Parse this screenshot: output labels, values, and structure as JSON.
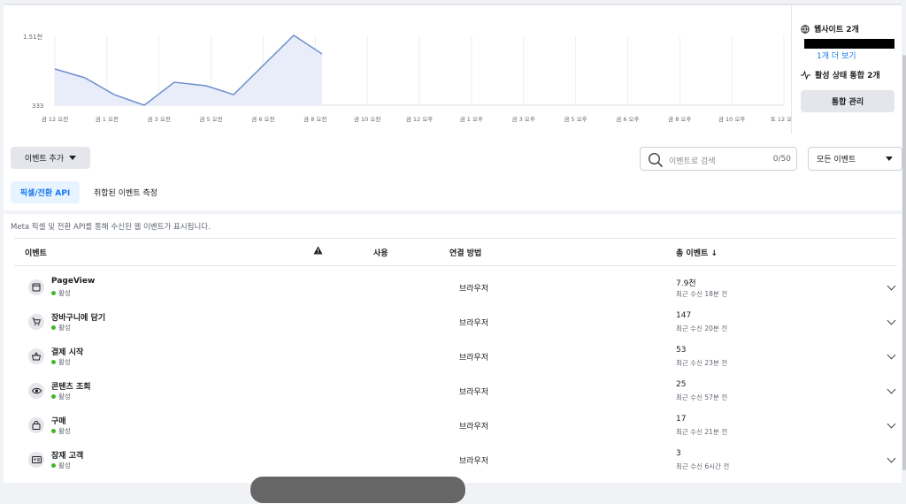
{
  "chart": {
    "y_labels": {
      "top": "1.51천",
      "bottom": "333"
    },
    "x_labels": [
      "금 12 오전",
      "금 1 오전",
      "금 3 오전",
      "금 5 오전",
      "금 6 오전",
      "금 8 오전",
      "금 10 오전",
      "금 12 오후",
      "금 1 오후",
      "금 3 오후",
      "금 5 오후",
      "금 6 오후",
      "금 8 오후",
      "금 10 오후",
      "토 12 오전"
    ],
    "line_color": "#6f8fce",
    "fill_color": "#e9edf9"
  },
  "sidebar": {
    "websites": "웹사이트 2개",
    "more_link": "1개 더 보기",
    "integrations": "활성 상태 통합 2개",
    "manage_button": "통합 관리"
  },
  "toolbar": {
    "add_event": "이벤트 추가",
    "search_placeholder": "이벤트로 검색",
    "search_count": "0/50",
    "filter_value": "모든 이벤트"
  },
  "tabs": {
    "active": "픽셀/전환 API",
    "other": "취합된 이벤트 측정"
  },
  "description": "Meta 픽셀 및 전환 API를 통해 수신된 웹 이벤트가 표시됩니다.",
  "table": {
    "headers": {
      "event": "이벤트",
      "usage": "사용",
      "method": "연결 방법",
      "total": "총 이벤트 ↓"
    },
    "rows": [
      {
        "icon": "browser-window-icon",
        "name": "PageView",
        "status": "활성",
        "method": "브라우저",
        "total": "7.9천",
        "received": "최근 수신 18분 전"
      },
      {
        "icon": "cart-icon",
        "name": "장바구니에 담기",
        "status": "활성",
        "method": "브라우저",
        "total": "147",
        "received": "최근 수신 20분 전"
      },
      {
        "icon": "basket-icon",
        "name": "결제 시작",
        "status": "활성",
        "method": "브라우저",
        "total": "53",
        "received": "최근 수신 23분 전"
      },
      {
        "icon": "eye-icon",
        "name": "콘텐츠 조회",
        "status": "활성",
        "method": "브라우저",
        "total": "25",
        "received": "최근 수신 57분 전"
      },
      {
        "icon": "shopping-bag-icon",
        "name": "구매",
        "status": "활성",
        "method": "브라우저",
        "total": "17",
        "received": "최근 수신 21분 전"
      },
      {
        "icon": "id-card-icon",
        "name": "잠재 고객",
        "status": "활성",
        "method": "브라우저",
        "total": "3",
        "received": "최근 수신 6시간 전"
      }
    ]
  },
  "colors": {
    "accent": "#1877f2",
    "active_dot": "#42b72a"
  }
}
